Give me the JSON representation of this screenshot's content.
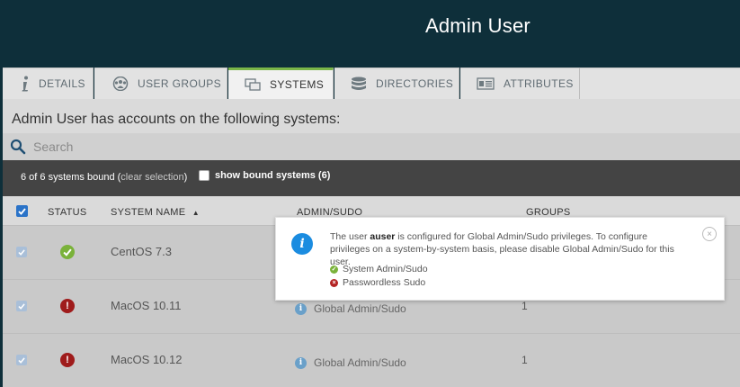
{
  "header": {
    "title": "Admin User"
  },
  "tabs": [
    {
      "label": "DETAILS",
      "icon": "info-icon",
      "active": false
    },
    {
      "label": "USER GROUPS",
      "icon": "user-groups-icon",
      "active": false
    },
    {
      "label": "SYSTEMS",
      "icon": "systems-icon",
      "active": true
    },
    {
      "label": "DIRECTORIES",
      "icon": "directories-icon",
      "active": false
    },
    {
      "label": "ATTRIBUTES",
      "icon": "attributes-icon",
      "active": false
    }
  ],
  "main": {
    "heading": "Admin User has accounts on the following systems:",
    "search": {
      "placeholder": "Search",
      "value": ""
    },
    "bind_bar": {
      "count_text": "6 of 6 systems bound (",
      "clear_label": "clear selection",
      "count_suffix": ")",
      "show_bound_label": "show bound systems (6)",
      "show_bound_checked": false
    },
    "columns": [
      "STATUS",
      "SYSTEM NAME",
      "ADMIN/SUDO",
      "GROUPS"
    ],
    "sort_indicator": "▲",
    "rows": [
      {
        "checked": true,
        "status": "ok",
        "name": "CentOS 7.3",
        "admin": "",
        "groups": ""
      },
      {
        "checked": true,
        "status": "error",
        "name": "MacOS 10.11",
        "admin": "Global Admin/Sudo",
        "groups": "1"
      },
      {
        "checked": true,
        "status": "error",
        "name": "MacOS 10.12",
        "admin": "Global Admin/Sudo",
        "groups": "1"
      }
    ]
  },
  "tooltip": {
    "text_before": "The user ",
    "username": "auser",
    "text_after": " is configured for Global Admin/Sudo privileges. To configure privileges on a system-by-system basis, please disable Global Admin/Sudo for this user.",
    "items": [
      {
        "label": "System Admin/Sudo",
        "state": "enabled"
      },
      {
        "label": "Passwordless Sudo",
        "state": "disabled"
      }
    ],
    "close_glyph": "×"
  },
  "colors": {
    "header_bg": "#0e2f3a",
    "active_tab_accent": "#7ab648",
    "status_ok": "#7ab23a",
    "status_error": "#9f1b1b",
    "info_blue": "#1b8ce0"
  }
}
